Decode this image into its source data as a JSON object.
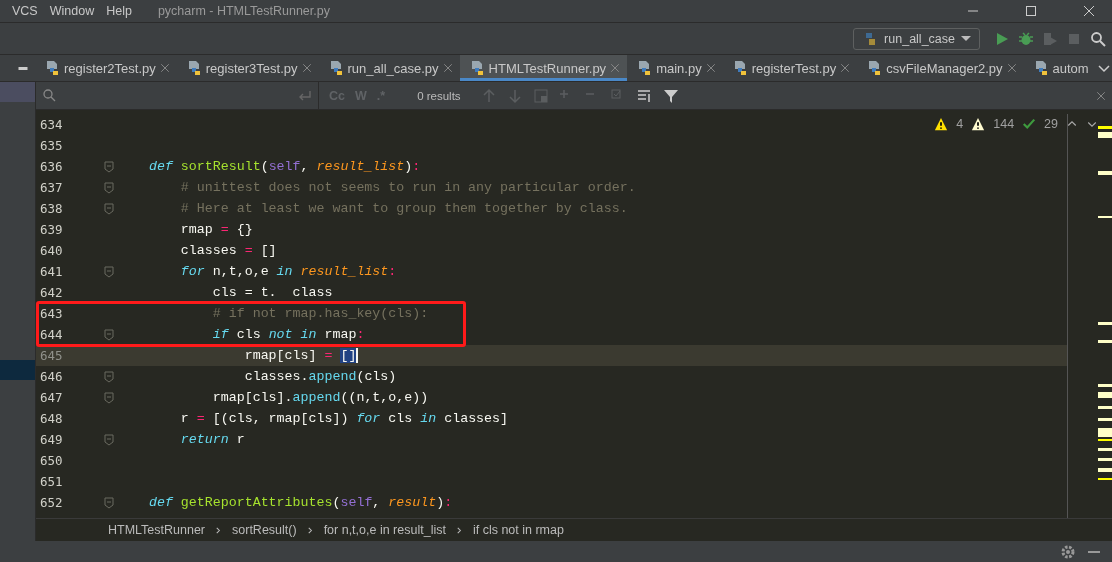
{
  "menu": [
    {
      "label": "VCS"
    },
    {
      "label": "Window"
    },
    {
      "label": "Help"
    }
  ],
  "window": {
    "title": "pycharm - HTMLTestRunner.py"
  },
  "run_config": {
    "label": "run_all_case"
  },
  "tabs": [
    {
      "label": "register2Test.py",
      "selected": false,
      "closable": true
    },
    {
      "label": "register3Test.py",
      "selected": false,
      "closable": true
    },
    {
      "label": "run_all_case.py",
      "selected": false,
      "closable": true
    },
    {
      "label": "HTMLTestRunner.py",
      "selected": true,
      "closable": true
    },
    {
      "label": "main.py",
      "selected": false,
      "closable": true
    },
    {
      "label": "registerTest.py",
      "selected": false,
      "closable": true
    },
    {
      "label": "csvFileManager2.py",
      "selected": false,
      "closable": true
    },
    {
      "label": "autom",
      "selected": false,
      "closable": false
    }
  ],
  "search": {
    "toggles": [
      "Cc",
      "W",
      ".*"
    ],
    "results": "0 results"
  },
  "inspections": {
    "errors": "4",
    "warnings": "144",
    "typos": "29"
  },
  "code_lines": [
    {
      "number": "634",
      "fold": false,
      "current": false,
      "boxed": false
    },
    {
      "number": "635",
      "fold": false,
      "current": false,
      "boxed": false
    },
    {
      "number": "636",
      "fold": true,
      "current": false,
      "boxed": false,
      "tokens": [
        {
          "kind": "kw",
          "text": "    def"
        },
        {
          "kind": "fn",
          "text": " sortResult"
        },
        {
          "kind": "plain",
          "text": "("
        },
        {
          "kind": "self",
          "text": "self"
        },
        {
          "kind": "plain",
          "text": ", "
        },
        {
          "kind": "param",
          "text": "result_list"
        },
        {
          "kind": "plain",
          "text": ")"
        },
        {
          "kind": "op",
          "text": ":"
        }
      ]
    },
    {
      "number": "637",
      "fold": true,
      "current": false,
      "boxed": false,
      "tokens": [
        {
          "kind": "comment",
          "text": "        # unittest does not seems to run in any particular order."
        }
      ]
    },
    {
      "number": "638",
      "fold": true,
      "current": false,
      "boxed": false,
      "tokens": [
        {
          "kind": "comment",
          "text": "        # Here at least we want to group them together by class."
        }
      ]
    },
    {
      "number": "639",
      "fold": false,
      "current": false,
      "boxed": false,
      "tokens": [
        {
          "kind": "plain",
          "text": "        rmap "
        },
        {
          "kind": "op",
          "text": "="
        },
        {
          "kind": "plain",
          "text": " {}"
        }
      ]
    },
    {
      "number": "640",
      "fold": false,
      "current": false,
      "boxed": false,
      "tokens": [
        {
          "kind": "plain",
          "text": "        classes "
        },
        {
          "kind": "op",
          "text": "="
        },
        {
          "kind": "plain",
          "text": " []"
        }
      ]
    },
    {
      "number": "641",
      "fold": true,
      "current": false,
      "boxed": false,
      "tokens": [
        {
          "kind": "kw",
          "text": "        for"
        },
        {
          "kind": "plain",
          "text": " n,t,o,e "
        },
        {
          "kind": "kw",
          "text": "in"
        },
        {
          "kind": "param",
          "text": " result_list"
        },
        {
          "kind": "op",
          "text": ":"
        }
      ]
    },
    {
      "number": "642",
      "fold": false,
      "current": false,
      "boxed": false,
      "tokens": [
        {
          "kind": "plain",
          "text": "            cls = t.  class"
        }
      ]
    },
    {
      "number": "643",
      "fold": false,
      "current": false,
      "boxed": true,
      "tokens": [
        {
          "kind": "comment",
          "text": "            # if not rmap.has_key(cls):"
        }
      ]
    },
    {
      "number": "644",
      "fold": true,
      "current": false,
      "boxed": true,
      "tokens": [
        {
          "kind": "kw",
          "text": "            if"
        },
        {
          "kind": "plain",
          "text": " cls "
        },
        {
          "kind": "kw",
          "text": "not"
        },
        {
          "kind": "kw",
          "text": " in"
        },
        {
          "kind": "plain",
          "text": " rmap"
        },
        {
          "kind": "op",
          "text": ":"
        }
      ]
    },
    {
      "number": "645",
      "fold": false,
      "current": true,
      "boxed": false,
      "tokens": [
        {
          "kind": "plain",
          "text": "                rmap[cls] "
        },
        {
          "kind": "op",
          "text": "= "
        },
        {
          "kind": "selected",
          "text": "[]"
        }
      ]
    },
    {
      "number": "646",
      "fold": true,
      "current": false,
      "boxed": false,
      "tokens": [
        {
          "kind": "plain",
          "text": "                classes."
        },
        {
          "kind": "call",
          "text": "append"
        },
        {
          "kind": "plain",
          "text": "(cls)"
        }
      ]
    },
    {
      "number": "647",
      "fold": true,
      "current": false,
      "boxed": false,
      "tokens": [
        {
          "kind": "plain",
          "text": "            rmap[cls]."
        },
        {
          "kind": "call",
          "text": "append"
        },
        {
          "kind": "plain",
          "text": "((n,t,o,e))"
        }
      ]
    },
    {
      "number": "648",
      "fold": false,
      "current": false,
      "boxed": false,
      "tokens": [
        {
          "kind": "plain",
          "text": "        r "
        },
        {
          "kind": "op",
          "text": "="
        },
        {
          "kind": "plain",
          "text": " [(cls, rmap[cls]) "
        },
        {
          "kind": "kw",
          "text": "for"
        },
        {
          "kind": "plain",
          "text": " cls "
        },
        {
          "kind": "kw",
          "text": "in"
        },
        {
          "kind": "plain",
          "text": " classes]"
        }
      ]
    },
    {
      "number": "649",
      "fold": true,
      "current": false,
      "boxed": false,
      "tokens": [
        {
          "kind": "kw",
          "text": "        return"
        },
        {
          "kind": "plain",
          "text": " r"
        }
      ]
    },
    {
      "number": "650",
      "fold": false,
      "current": false,
      "boxed": false
    },
    {
      "number": "651",
      "fold": false,
      "current": false,
      "boxed": false
    },
    {
      "number": "652",
      "fold": true,
      "current": false,
      "boxed": false,
      "tokens": [
        {
          "kind": "kw",
          "text": "    def"
        },
        {
          "kind": "fn",
          "text": " getReportAttributes"
        },
        {
          "kind": "plain",
          "text": "("
        },
        {
          "kind": "self",
          "text": "self"
        },
        {
          "kind": "plain",
          "text": ", "
        },
        {
          "kind": "param",
          "text": "result"
        },
        {
          "kind": "plain",
          "text": ")"
        },
        {
          "kind": "op",
          "text": ":"
        }
      ]
    }
  ],
  "breadcrumbs": [
    "HTMLTestRunner",
    "sortResult()",
    "for n,t,o,e in result_list",
    "if cls not in rmap"
  ]
}
